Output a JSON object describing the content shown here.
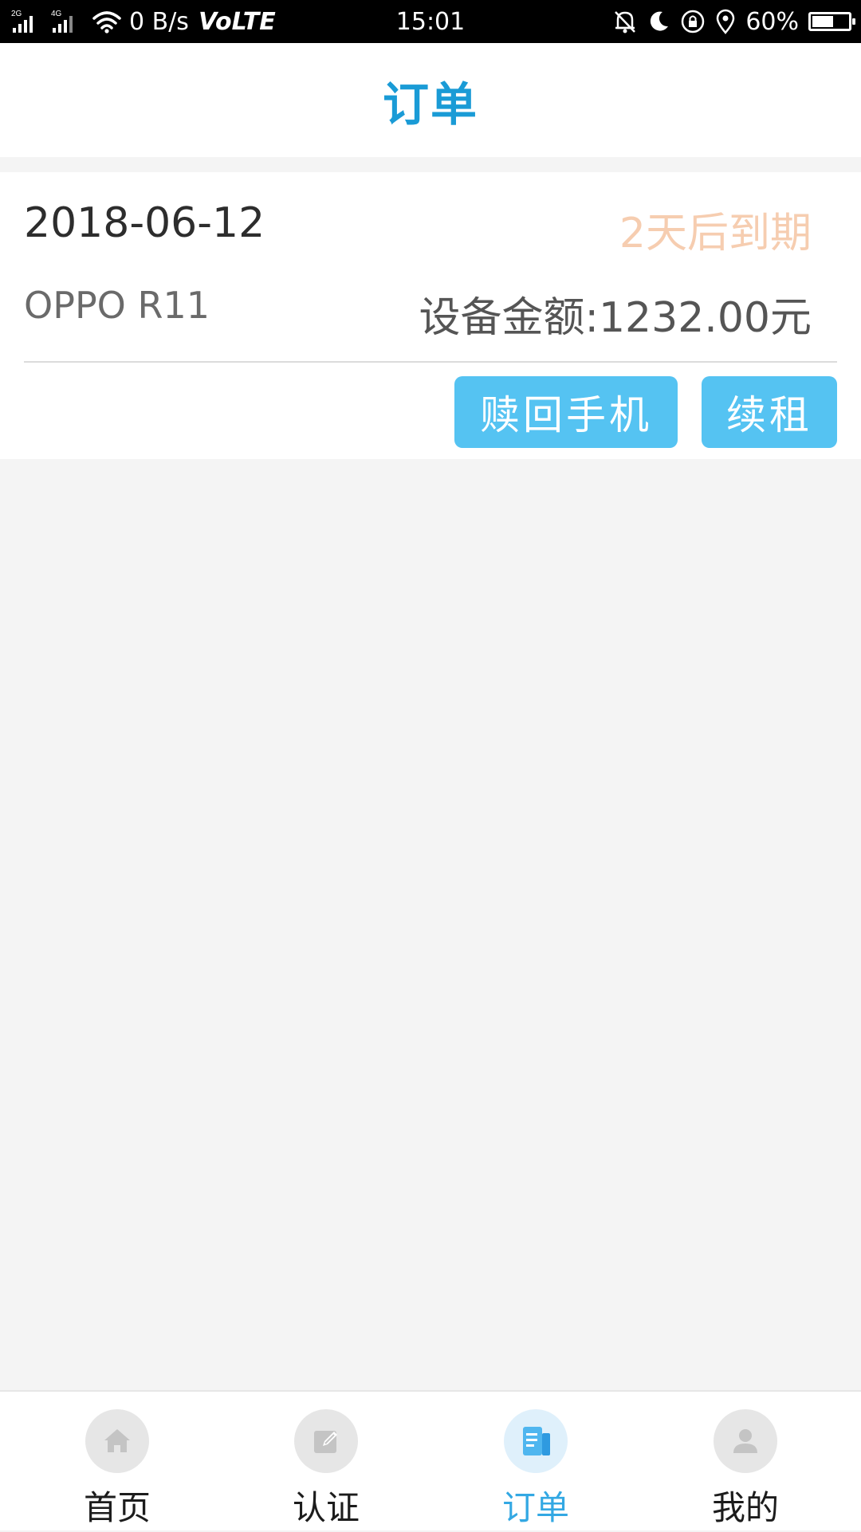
{
  "status_bar": {
    "signal_label_1": "2G",
    "signal_label_2": "4G",
    "network_speed": "0 B/s",
    "volte": "VoLTE",
    "time": "15:01",
    "battery_percent": "60%",
    "battery_level": 0.6
  },
  "header": {
    "title": "订单"
  },
  "order": {
    "date": "2018-06-12",
    "status": "2天后到期",
    "device": "OPPO R11",
    "amount": "设备金额:1232.00元",
    "redeem_label": "赎回手机",
    "renew_label": "续租"
  },
  "bottom_nav": {
    "items": [
      {
        "label": "首页",
        "icon": "home-icon",
        "active": false
      },
      {
        "label": "认证",
        "icon": "edit-icon",
        "active": false
      },
      {
        "label": "订单",
        "icon": "order-icon",
        "active": true
      },
      {
        "label": "我的",
        "icon": "user-icon",
        "active": false
      }
    ]
  },
  "colors": {
    "accent": "#1a9bd6",
    "button": "#55c3f2",
    "status_warning": "#f6cdb0",
    "nav_active": "#33a8e3"
  }
}
